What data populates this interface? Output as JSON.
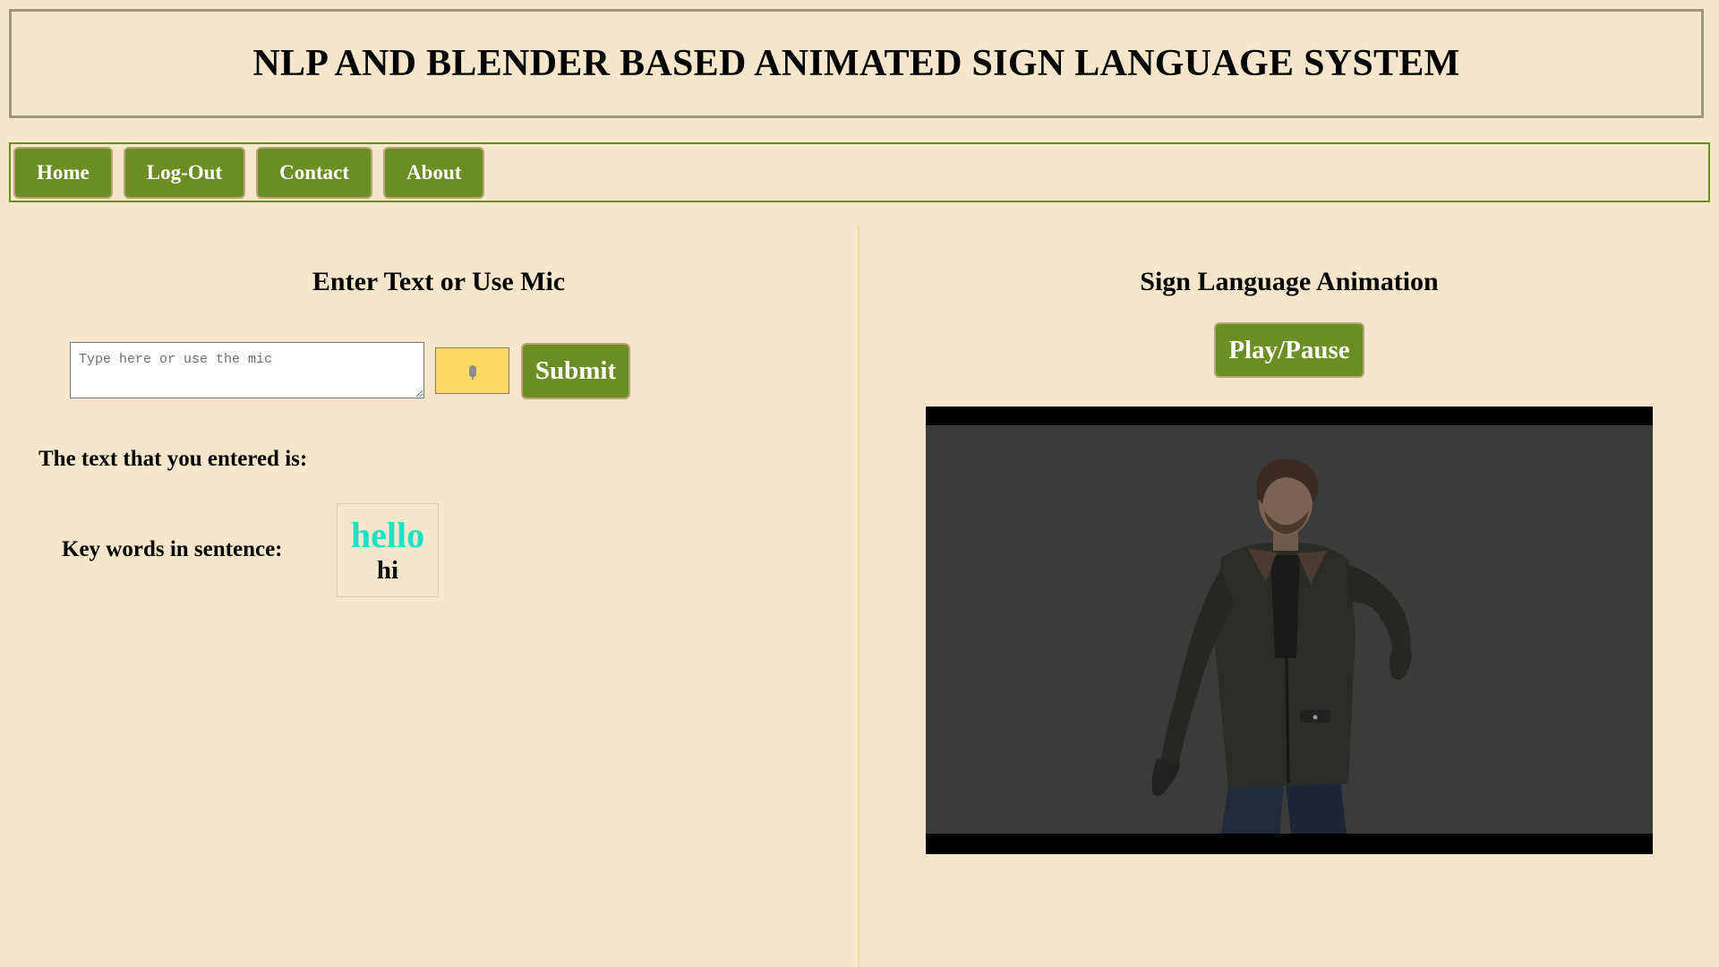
{
  "header": {
    "title": "NLP AND BLENDER BASED ANIMATED SIGN LANGUAGE SYSTEM"
  },
  "nav": {
    "items": [
      {
        "label": "Home"
      },
      {
        "label": "Log-Out"
      },
      {
        "label": "Contact"
      },
      {
        "label": "About"
      }
    ]
  },
  "input_panel": {
    "heading": "Enter Text or Use Mic",
    "text_input": {
      "value": "",
      "placeholder": "Type here or use the mic"
    },
    "mic_icon": "microphone-icon",
    "submit_label": "Submit",
    "entered_label": "The text that you entered is:",
    "entered_text": "",
    "keywords_label": "Key words in sentence:",
    "keywords": [
      "hello",
      "hi"
    ],
    "active_keyword_color": "#1de0c6"
  },
  "animation_panel": {
    "heading": "Sign Language Animation",
    "play_pause_label": "Play/Pause"
  },
  "colors": {
    "background": "#f5e6cc",
    "accent": "#6b8e23",
    "mic_button": "#ffd966",
    "video_background": "#3b3b3b"
  }
}
